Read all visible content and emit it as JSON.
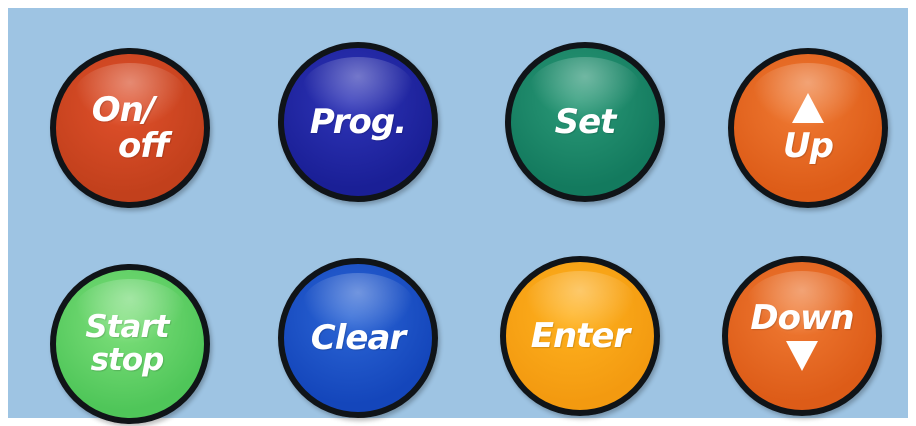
{
  "keypad": {
    "onoff": {
      "line1": "On/",
      "line2": "off",
      "color": "#d0461f"
    },
    "prog": {
      "label": "Prog.",
      "color": "#2024a6"
    },
    "set": {
      "label": "Set",
      "color": "#168466"
    },
    "up": {
      "label": "Up",
      "icon": "triangle-up-icon",
      "color": "#e36520"
    },
    "start": {
      "line1": "Start",
      "line2": "stop",
      "color": "#5ccf62"
    },
    "clear": {
      "label": "Clear",
      "color": "#1a55c8"
    },
    "enter": {
      "label": "Enter",
      "color": "#f8a514"
    },
    "down": {
      "label": "Down",
      "icon": "triangle-down-icon",
      "color": "#e36520"
    }
  },
  "panel": {
    "background": "#9ec4e3"
  }
}
